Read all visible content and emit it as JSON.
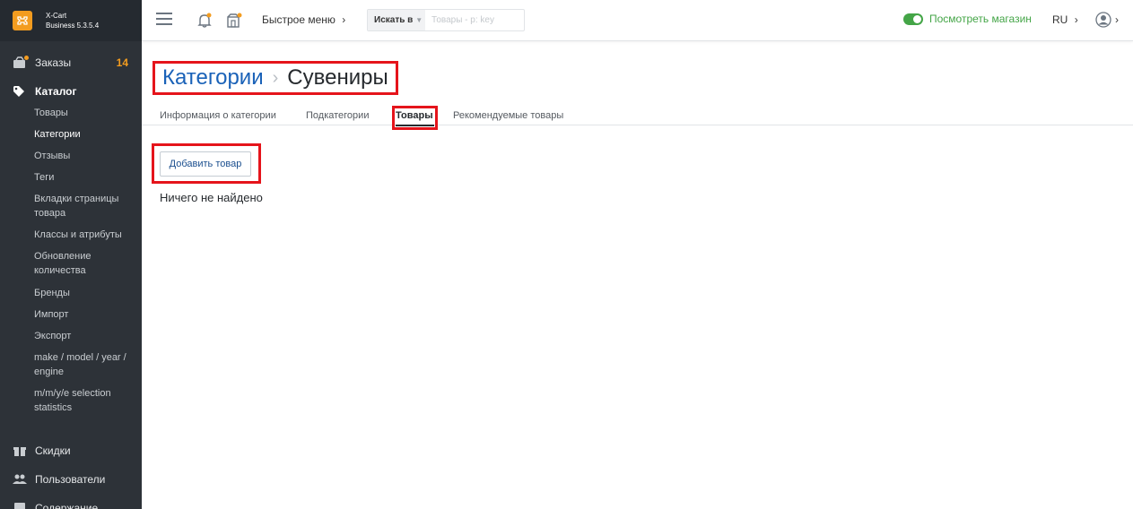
{
  "app": {
    "brand_line1": "X-Cart",
    "brand_line2": "Business 5.3.5.4"
  },
  "header": {
    "quick_menu": "Быстрое меню",
    "search_scope": "Искать в",
    "search_placeholder": "Товары - p: key",
    "store_link": "Посмотреть магазин",
    "language": "RU"
  },
  "sidebar": {
    "orders": {
      "label": "Заказы",
      "count": "14"
    },
    "catalog": {
      "label": "Каталог"
    },
    "catalog_items": [
      "Товары",
      "Категории",
      "Отзывы",
      "Теги",
      "Вкладки страницы товара",
      "Классы и атрибуты",
      "Обновление количества",
      "Бренды",
      "Импорт",
      "Экспорт",
      "make / model / year / engine",
      "m/m/y/e selection statistics"
    ],
    "discounts": {
      "label": "Скидки"
    },
    "users": {
      "label": "Пользователи"
    },
    "content": {
      "label": "Содержание"
    }
  },
  "page": {
    "breadcrumb_parent": "Категории",
    "breadcrumb_current": "Сувениры",
    "tabs": [
      "Информация о категории",
      "Подкатегории",
      "Товары",
      "Рекомендуемые товары"
    ],
    "add_button": "Добавить товар",
    "empty_message": "Ничего не найдено"
  },
  "colors": {
    "sidebar_bg": "#2d3238",
    "accent_orange": "#f39c1f",
    "link_blue": "#1a62b8",
    "store_green": "#44a547",
    "highlight_red": "#e5141b"
  }
}
